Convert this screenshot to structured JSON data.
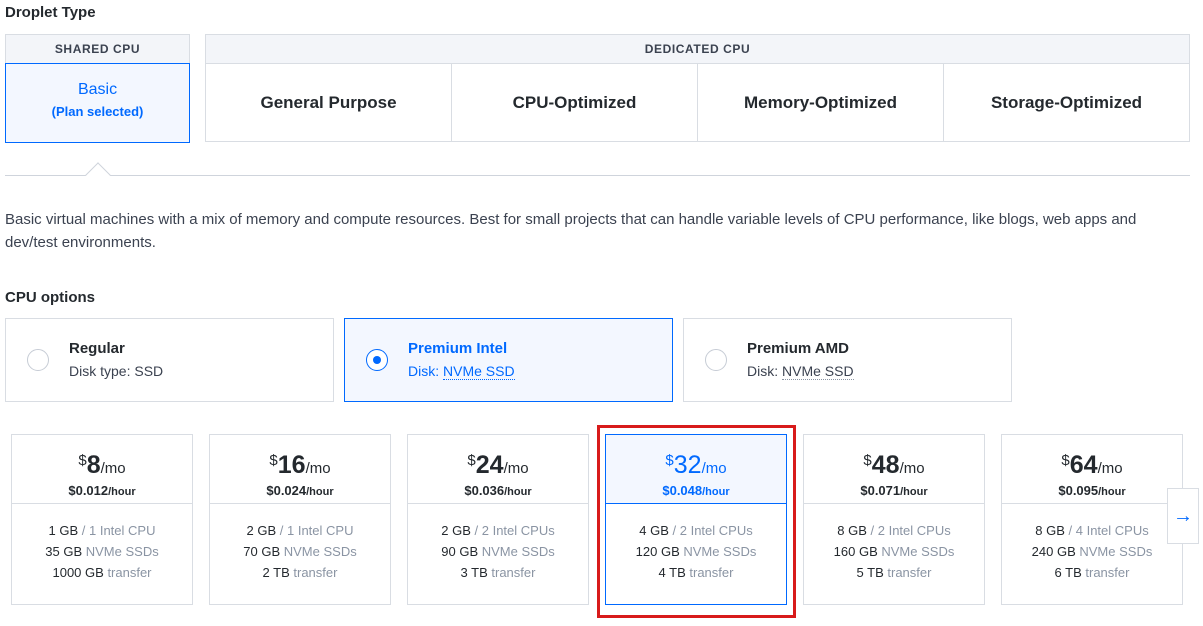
{
  "droplet_type": {
    "title": "Droplet Type",
    "shared_header": "SHARED CPU",
    "dedicated_header": "DEDICATED CPU",
    "basic": {
      "label": "Basic",
      "selected_note": "(Plan selected)"
    },
    "dedicated_options": [
      "General Purpose",
      "CPU-Optimized",
      "Memory-Optimized",
      "Storage-Optimized"
    ]
  },
  "description": "Basic virtual machines with a mix of memory and compute resources. Best for small projects that can handle variable levels of CPU performance, like blogs, web apps and dev/test environments.",
  "cpu_options": {
    "title": "CPU options",
    "disk_prefix": "Disk:",
    "options": [
      {
        "name": "Regular",
        "disk_line": "Disk type: SSD",
        "selected": false
      },
      {
        "name": "Premium Intel",
        "disk_value": "NVMe SSD",
        "selected": true
      },
      {
        "name": "Premium AMD",
        "disk_value": "NVMe SSD",
        "selected": false
      }
    ]
  },
  "plans": [
    {
      "currency": "$",
      "amount": "8",
      "per": "/mo",
      "hourly": "$0.012",
      "hourly_unit": "/hour",
      "memory": "1 GB",
      "cpu": "/ 1 Intel CPU",
      "storage": "35 GB",
      "storage_label": "NVMe SSDs",
      "transfer": "1000 GB",
      "transfer_label": "transfer",
      "selected": false
    },
    {
      "currency": "$",
      "amount": "16",
      "per": "/mo",
      "hourly": "$0.024",
      "hourly_unit": "/hour",
      "memory": "2 GB",
      "cpu": "/ 1 Intel CPU",
      "storage": "70 GB",
      "storage_label": "NVMe SSDs",
      "transfer": "2 TB",
      "transfer_label": "transfer",
      "selected": false
    },
    {
      "currency": "$",
      "amount": "24",
      "per": "/mo",
      "hourly": "$0.036",
      "hourly_unit": "/hour",
      "memory": "2 GB",
      "cpu": "/ 2 Intel CPUs",
      "storage": "90 GB",
      "storage_label": "NVMe SSDs",
      "transfer": "3 TB",
      "transfer_label": "transfer",
      "selected": false
    },
    {
      "currency": "$",
      "amount": "32",
      "per": "/mo",
      "hourly": "$0.048",
      "hourly_unit": "/hour",
      "memory": "4 GB",
      "cpu": "/ 2 Intel CPUs",
      "storage": "120 GB",
      "storage_label": "NVMe SSDs",
      "transfer": "4 TB",
      "transfer_label": "transfer",
      "selected": true
    },
    {
      "currency": "$",
      "amount": "48",
      "per": "/mo",
      "hourly": "$0.071",
      "hourly_unit": "/hour",
      "memory": "8 GB",
      "cpu": "/ 2 Intel CPUs",
      "storage": "160 GB",
      "storage_label": "NVMe SSDs",
      "transfer": "5 TB",
      "transfer_label": "transfer",
      "selected": false
    },
    {
      "currency": "$",
      "amount": "64",
      "per": "/mo",
      "hourly": "$0.095",
      "hourly_unit": "/hour",
      "memory": "8 GB",
      "cpu": "/ 4 Intel CPUs",
      "storage": "240 GB",
      "storage_label": "NVMe SSDs",
      "transfer": "6 TB",
      "transfer_label": "transfer",
      "selected": false
    }
  ],
  "next_icon": "→",
  "colors": {
    "accent": "#0069ff",
    "highlight": "#d81b1b",
    "selected_bg": "#f3f7ff",
    "muted": "#8a94a3"
  }
}
